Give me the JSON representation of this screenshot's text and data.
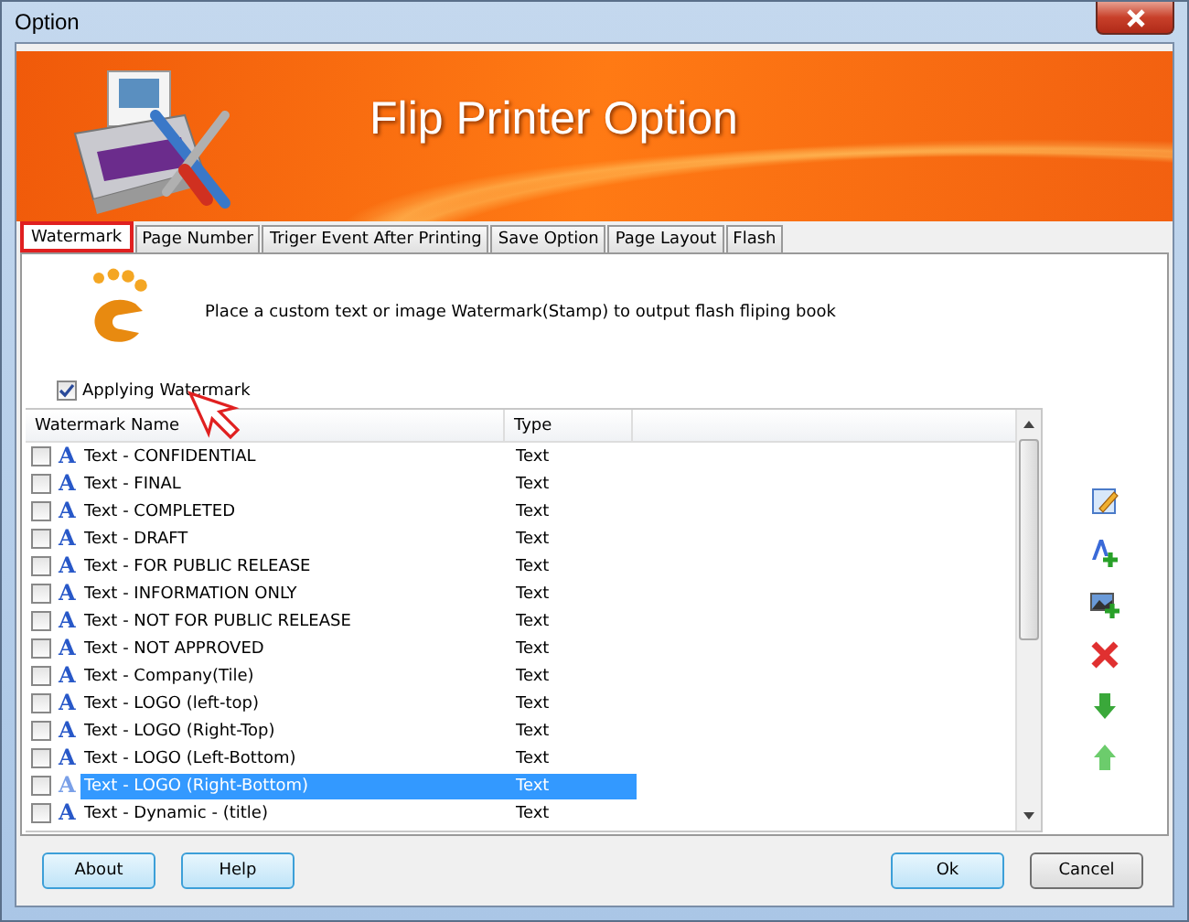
{
  "window": {
    "title": "Option"
  },
  "banner": {
    "title": "Flip Printer Option"
  },
  "tabs": [
    {
      "label": "Watermark",
      "selected": true
    },
    {
      "label": "Page Number",
      "selected": false
    },
    {
      "label": "Triger Event After Printing",
      "selected": false
    },
    {
      "label": "Save Option",
      "selected": false
    },
    {
      "label": "Page Layout",
      "selected": false
    },
    {
      "label": "Flash",
      "selected": false
    }
  ],
  "description": "Place a custom text or image Watermark(Stamp) to output flash fliping book",
  "apply_watermark": {
    "label": "Applying Watermark",
    "checked": true
  },
  "table": {
    "columns": [
      "Watermark Name",
      "Type"
    ],
    "rows": [
      {
        "icon_glyph": "A",
        "name": "Text - CONFIDENTIAL",
        "type": "Text",
        "checked": false,
        "selected": false
      },
      {
        "icon_glyph": "A",
        "name": "Text - FINAL",
        "type": "Text",
        "checked": false,
        "selected": false
      },
      {
        "icon_glyph": "A",
        "name": "Text - COMPLETED",
        "type": "Text",
        "checked": false,
        "selected": false
      },
      {
        "icon_glyph": "A",
        "name": "Text - DRAFT",
        "type": "Text",
        "checked": false,
        "selected": false
      },
      {
        "icon_glyph": "A",
        "name": "Text - FOR PUBLIC RELEASE",
        "type": "Text",
        "checked": false,
        "selected": false
      },
      {
        "icon_glyph": "A",
        "name": "Text - INFORMATION ONLY",
        "type": "Text",
        "checked": false,
        "selected": false
      },
      {
        "icon_glyph": "A",
        "name": "Text - NOT FOR PUBLIC RELEASE",
        "type": "Text",
        "checked": false,
        "selected": false
      },
      {
        "icon_glyph": "A",
        "name": "Text - NOT APPROVED",
        "type": "Text",
        "checked": false,
        "selected": false
      },
      {
        "icon_glyph": "A",
        "name": "Text - Company(Tile)",
        "type": "Text",
        "checked": false,
        "selected": false
      },
      {
        "icon_glyph": "A",
        "name": "Text - LOGO (left-top)",
        "type": "Text",
        "checked": false,
        "selected": false
      },
      {
        "icon_glyph": "A",
        "name": "Text - LOGO (Right-Top)",
        "type": "Text",
        "checked": false,
        "selected": false
      },
      {
        "icon_glyph": "A",
        "name": "Text - LOGO (Left-Bottom)",
        "type": "Text",
        "checked": false,
        "selected": false
      },
      {
        "icon_glyph": "A",
        "name": "Text - LOGO (Right-Bottom)",
        "type": "Text",
        "checked": false,
        "selected": true
      },
      {
        "icon_glyph": "A",
        "name": "Text - Dynamic - (title)",
        "type": "Text",
        "checked": false,
        "selected": false
      }
    ]
  },
  "buttons_left": [
    "About",
    "Help"
  ],
  "buttons_right": [
    {
      "label": "Ok",
      "kind": "default"
    },
    {
      "label": "Cancel",
      "kind": "normal"
    }
  ]
}
